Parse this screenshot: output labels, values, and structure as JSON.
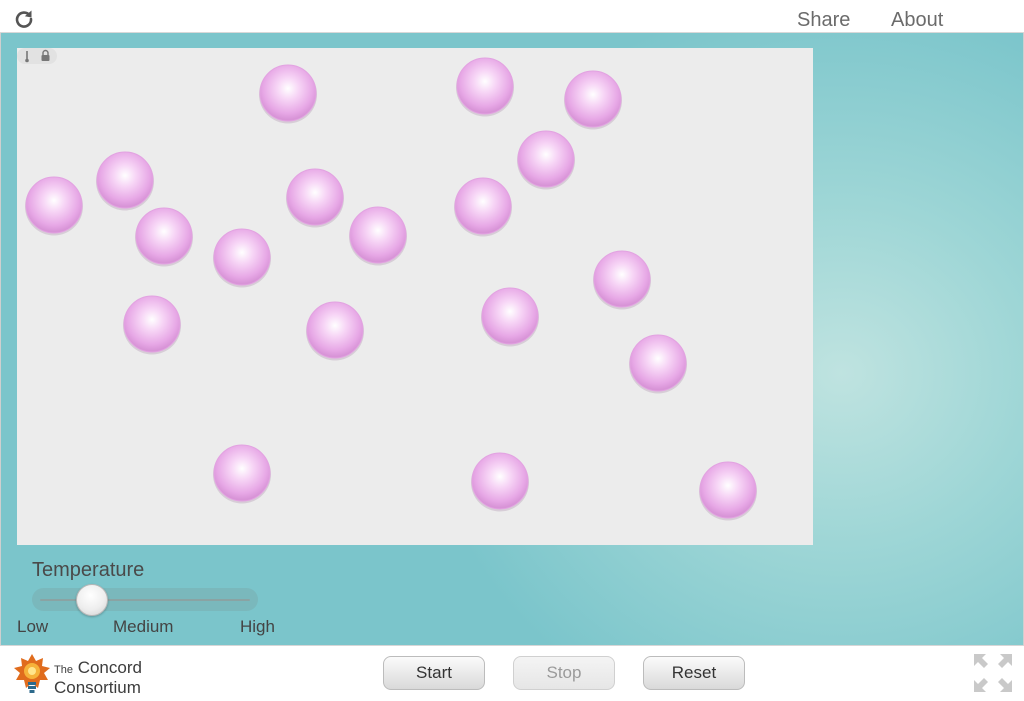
{
  "header": {
    "share_label": "Share",
    "about_label": "About",
    "reload_icon": "reload-icon"
  },
  "simulation": {
    "particle_color": "#f0b6ef",
    "background": "#ececec",
    "tool_icons": [
      "thermometer-icon",
      "lock-icon"
    ],
    "particle_count": 19
  },
  "temperature": {
    "label": "Temperature",
    "ticks": {
      "low": "Low",
      "medium": "Medium",
      "high": "High"
    },
    "value_fraction": 0.2
  },
  "footer": {
    "logo_line1_small": "The",
    "logo_line1": "Concord",
    "logo_line2": "Consortium",
    "start_label": "Start",
    "stop_label": "Stop",
    "reset_label": "Reset",
    "fullscreen_icon": "fullscreen-icon"
  }
}
